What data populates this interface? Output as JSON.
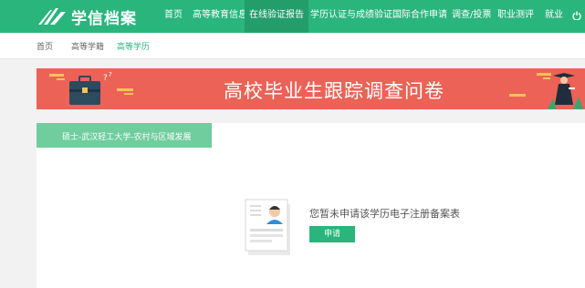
{
  "header": {
    "logo_text": "学信档案",
    "nav": [
      {
        "label": "首页",
        "active": false
      },
      {
        "label": "高等教育信息",
        "active": false
      },
      {
        "label": "在线验证报告",
        "active": true
      },
      {
        "label": "学历认证与成绩验证",
        "active": false
      },
      {
        "label": "国际合作申请",
        "active": false
      },
      {
        "label": "调查/投票",
        "active": false
      },
      {
        "label": "职业测评",
        "active": false
      },
      {
        "label": "就业",
        "active": false
      }
    ]
  },
  "subnav": {
    "items": [
      {
        "label": "首页",
        "active": false
      },
      {
        "label": "高等学籍",
        "active": false
      },
      {
        "label": "高等学历",
        "active": true
      }
    ]
  },
  "banner": {
    "title": "高校毕业生跟踪调查问卷"
  },
  "degree_tab": {
    "label": "硕士-武汉轻工大学-农村与区域发展"
  },
  "empty_state": {
    "message": "您暂未申请该学历电子注册备案表",
    "apply_label": "申请"
  },
  "colors": {
    "brand_green": "#29b57c",
    "banner_red": "#ec6256",
    "tab_green": "#6fcd9e"
  }
}
